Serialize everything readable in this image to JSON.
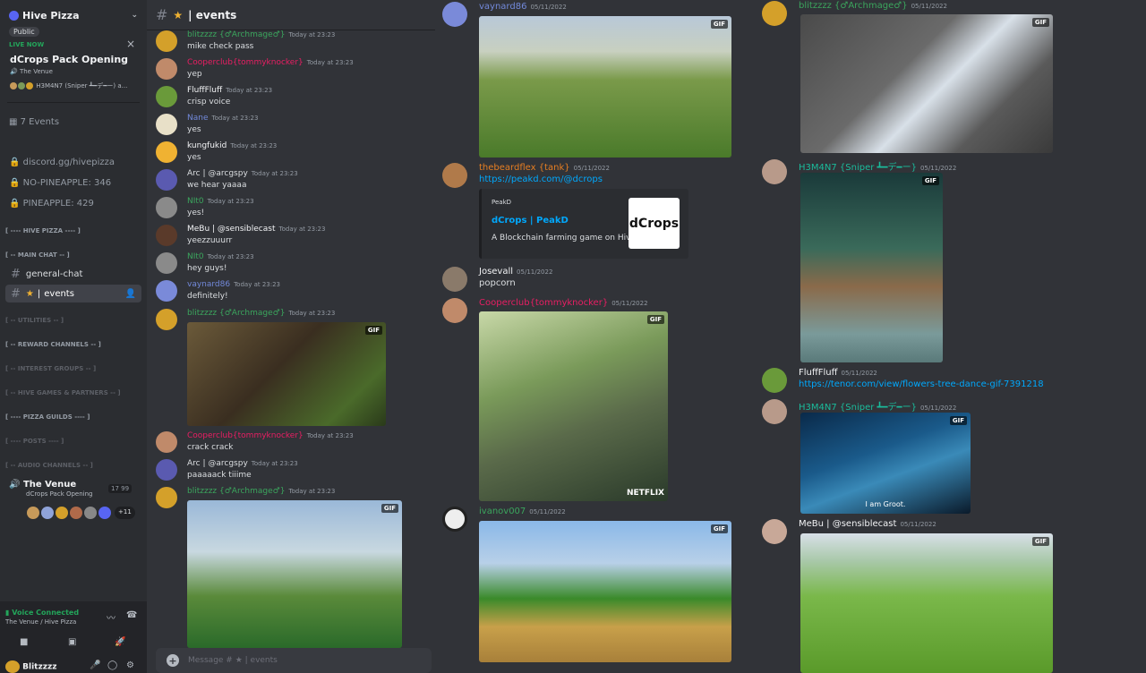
{
  "sidebar": {
    "server_name": "Hive Pizza",
    "badge": "Public",
    "live_label": "LIVE NOW",
    "event_title": "dCrops Pack Opening",
    "event_venue": "The Venue",
    "event_users": "H3M4N7 (Sniper ┻━デ━ー) a...",
    "events_count": "7 Events",
    "links": [
      "discord.gg/hivepizza",
      "NO-PINEAPPLE: 346",
      "PINEAPPLE: 429"
    ],
    "categories": [
      "[ ---- HIVE PIZZA ---- ]",
      "[ -- MAIN CHAT -- ]",
      "[ -- UTILITIES -- ]",
      "[ -- REWARD CHANNELS -- ]",
      "[ -- INTEREST GROUPS -- ]",
      "[ -- HIVE GAMES & PARTNERS -- ]",
      "[ ---- PIZZA GUILDS ---- ]",
      "[ ---- POSTS ---- ]",
      "[ -- AUDIO CHANNELS -- ]"
    ],
    "channel_general": "general-chat",
    "channel_events": "events",
    "voice_channel": "The Venue",
    "voice_sub": "dCrops Pack Opening",
    "voice_count": "17  99",
    "voice_more": "+11",
    "voice_connected": "Voice Connected",
    "voice_location": "The Venue / Hive Pizza",
    "username": "Blitzzzz"
  },
  "chat": {
    "channel_title": "| events",
    "composer_placeholder": "Message # ★ | events",
    "messages": [
      {
        "name": "blitzzzz {♂Archmage♂}",
        "time": "Today at 23:23",
        "text": "mike check pass",
        "color": "#3ba55d"
      },
      {
        "name": "Cooperclub{tommyknocker}",
        "time": "Today at 23:23",
        "text": "yep",
        "color": "#e91e63"
      },
      {
        "name": "FluffFluff",
        "time": "Today at 23:23",
        "text": "crisp voice",
        "color": "#f2f3f5"
      },
      {
        "name": "Nane",
        "time": "Today at 23:23",
        "text": "yes",
        "color": "#7289da"
      },
      {
        "name": "kungfukid",
        "time": "Today at 23:23",
        "text": "yes",
        "color": "#f2f3f5"
      },
      {
        "name": "Arc | @arcgspy",
        "time": "Today at 23:23",
        "text": "we hear yaaaa",
        "color": "#dbdee1"
      },
      {
        "name": "NIt0",
        "time": "Today at 23:23",
        "text": "yes!",
        "color": "#3ba55d"
      },
      {
        "name": "MeBu | @sensiblecast",
        "time": "Today at 23:23",
        "text": "yeezzuuurr",
        "color": "#f2f3f5"
      },
      {
        "name": "NIt0",
        "time": "Today at 23:23",
        "text": "hey guys!",
        "color": "#3ba55d"
      },
      {
        "name": "vaynard86",
        "time": "Today at 23:23",
        "text": "definitely!",
        "color": "#7289da"
      },
      {
        "name": "blitzzzz {♂Archmage♂}",
        "time": "Today at 23:23",
        "text": "",
        "color": "#3ba55d"
      },
      {
        "name": "Cooperclub{tommyknocker}",
        "time": "Today at 23:23",
        "text": "crack crack",
        "color": "#e91e63"
      },
      {
        "name": "Arc | @arcgspy",
        "time": "Today at 23:23",
        "text": "paaaaack tiiime",
        "color": "#dbdee1"
      },
      {
        "name": "blitzzzz {♂Archmage♂}",
        "time": "Today at 23:23",
        "text": "",
        "color": "#3ba55d"
      }
    ]
  },
  "feed1": {
    "m1": {
      "name": "vaynard86",
      "time": "05/11/2022",
      "color": "#7289da"
    },
    "m2": {
      "name": "thebeardflex {tank}",
      "time": "05/11/2022",
      "link": "https://peakd.com/@dcrops",
      "embed_provider": "PeakD",
      "embed_title": "dCrops | PeakD",
      "embed_desc": "A Blockchain farming game on Hive",
      "embed_logo": "dCrops",
      "color": "#e67e22"
    },
    "m3": {
      "name": "Josevall",
      "time": "05/11/2022",
      "text": "popcorn",
      "color": "#f2f3f5"
    },
    "m4": {
      "name": "Cooperclub{tommyknocker}",
      "time": "05/11/2022",
      "color": "#e91e63",
      "watermark": "NETFLIX"
    },
    "m5": {
      "name": "ivanov007",
      "time": "05/11/2022",
      "color": "#3ba55d"
    }
  },
  "feed2": {
    "m1": {
      "name": "blitzzzz {♂Archmage♂}",
      "time": "05/11/2022",
      "color": "#3ba55d"
    },
    "m2": {
      "name": "H3M4N7 {Sniper ┻━デ━ー}",
      "time": "05/11/2022",
      "color": "#1abc9c"
    },
    "m3": {
      "name": "FluffFluff",
      "time": "05/11/2022",
      "link": "https://tenor.com/view/flowers-tree-dance-gif-7391218",
      "color": "#f2f3f5"
    },
    "m4": {
      "name": "H3M4N7 {Sniper ┻━デ━ー}",
      "time": "05/11/2022",
      "color": "#1abc9c",
      "caption": "I am Groot."
    },
    "m5": {
      "name": "MeBu | @sensiblecast",
      "time": "05/11/2022",
      "color": "#f2f3f5"
    }
  },
  "gif_label": "GIF"
}
